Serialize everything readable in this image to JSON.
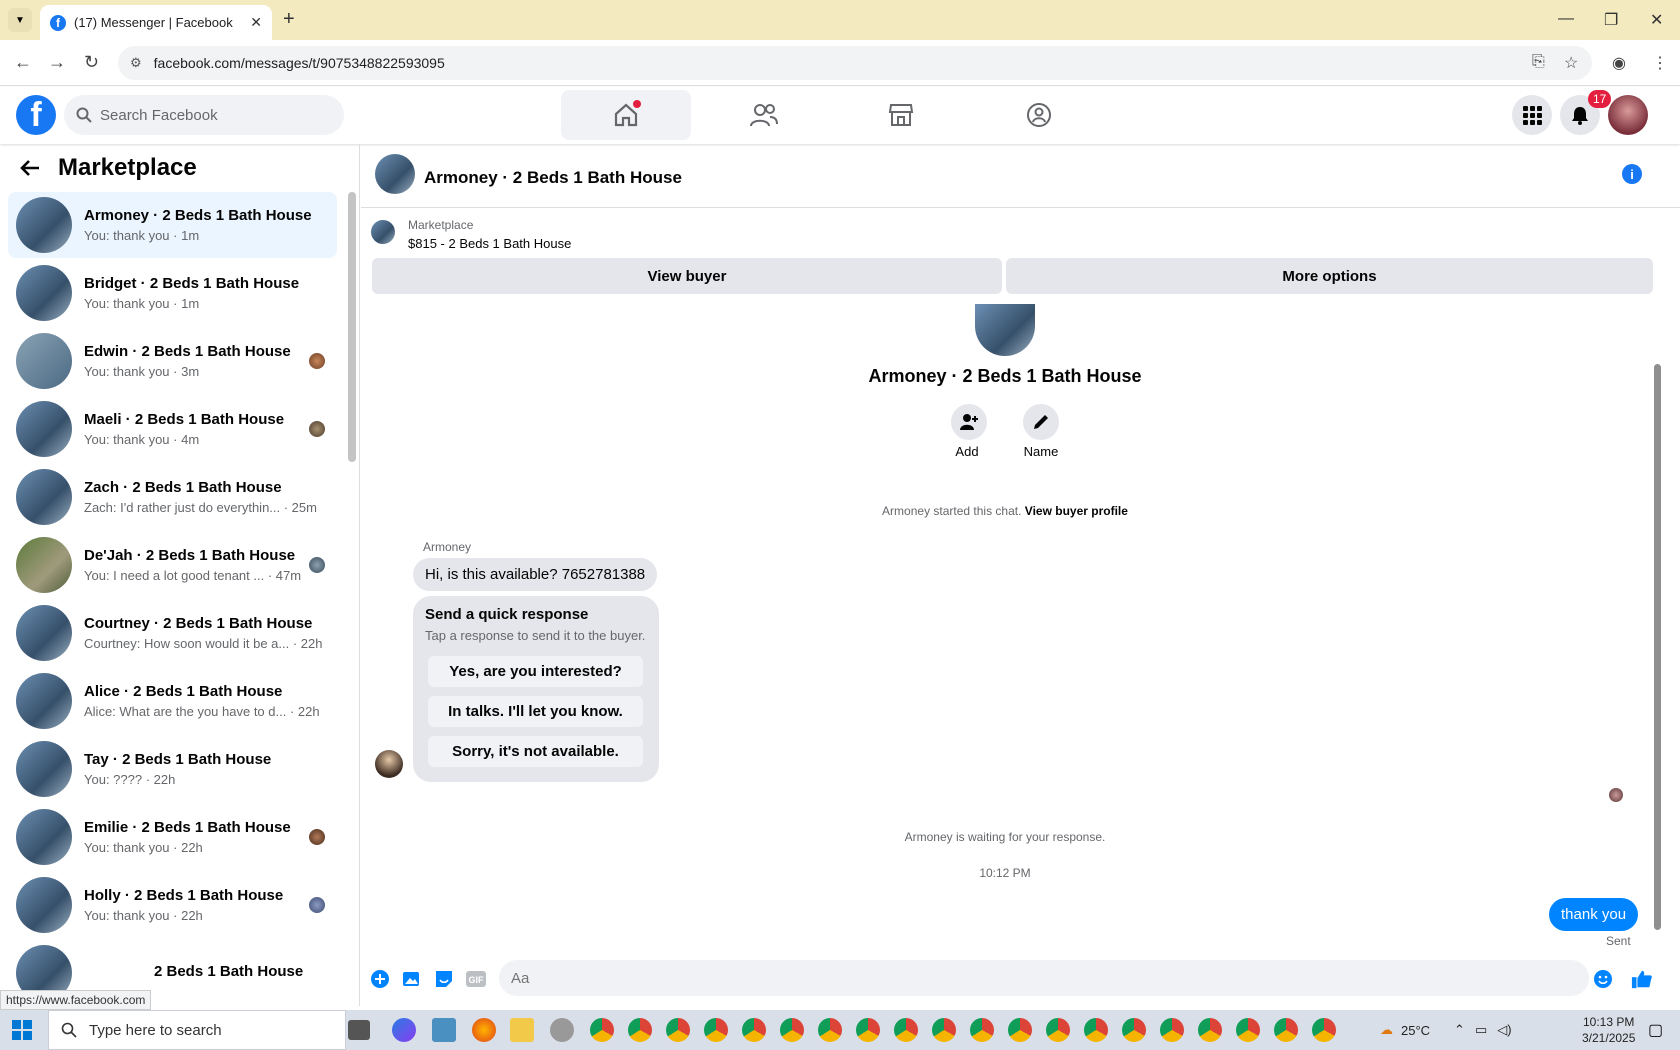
{
  "browser": {
    "tab_title": "(17) Messenger | Facebook",
    "url": "facebook.com/messages/t/9075348822593095",
    "status_url": "https://www.facebook.com"
  },
  "fb": {
    "search_placeholder": "Search Facebook",
    "notification_count": "17"
  },
  "sidebar": {
    "title": "Marketplace",
    "conversations": [
      {
        "name": "Armoney · 2 Beds 1 Bath House",
        "preview": "You: thank you · 1m",
        "selected": true
      },
      {
        "name": "Bridget · 2 Beds 1 Bath House",
        "preview": "You: thank you · 1m"
      },
      {
        "name": "Edwin · 2 Beds 1 Bath House",
        "preview": "You: thank you · 3m"
      },
      {
        "name": "Maeli · 2 Beds 1 Bath House",
        "preview": "You: thank you · 4m"
      },
      {
        "name": "Zach · 2 Beds 1 Bath House",
        "preview": "Zach: I'd rather just do everythin... · 25m"
      },
      {
        "name": "De'Jah · 2 Beds 1 Bath House",
        "preview": "You: I need a lot good tenant ... · 47m"
      },
      {
        "name": "Courtney · 2 Beds 1 Bath House",
        "preview": "Courtney: How soon would it be a... · 22h"
      },
      {
        "name": "Alice · 2 Beds 1 Bath House",
        "preview": "Alice: What are the you have to d... · 22h"
      },
      {
        "name": "Tay · 2 Beds 1 Bath House",
        "preview": "You: ???? · 22h"
      },
      {
        "name": "Emilie · 2 Beds 1 Bath House",
        "preview": "You: thank you · 22h"
      },
      {
        "name": "Holly · 2 Beds 1 Bath House",
        "preview": "You: thank you · 22h"
      },
      {
        "name": "2 Beds 1 Bath House",
        "preview": ""
      }
    ]
  },
  "chat": {
    "title": "Armoney · 2 Beds 1 Bath House",
    "marketplace_label": "Marketplace",
    "listing": "$815 - 2 Beds 1 Bath House",
    "view_buyer": "View buyer",
    "more_options": "More options",
    "header_name": "Armoney · 2 Beds 1 Bath House",
    "add_label": "Add",
    "name_label": "Name",
    "started_text": "Armoney started this chat.",
    "view_buyer_profile": "View buyer profile",
    "sender_name": "Armoney",
    "buyer_message": "Hi, is this available? 7652781388",
    "quick_response_title": "Send a quick response",
    "quick_response_sub": "Tap a response to send it to the buyer.",
    "quick_responses": [
      "Yes, are you interested?",
      "In talks. I'll let you know.",
      "Sorry, it's not available."
    ],
    "waiting_text": "Armoney is waiting for your response.",
    "timestamp": "10:12 PM",
    "my_message": "thank you",
    "sent_status": "Sent",
    "input_placeholder": "Aa"
  },
  "taskbar": {
    "search_placeholder": "Type here to search",
    "weather": "25°C",
    "time": "10:13 PM",
    "date": "3/21/2025"
  }
}
